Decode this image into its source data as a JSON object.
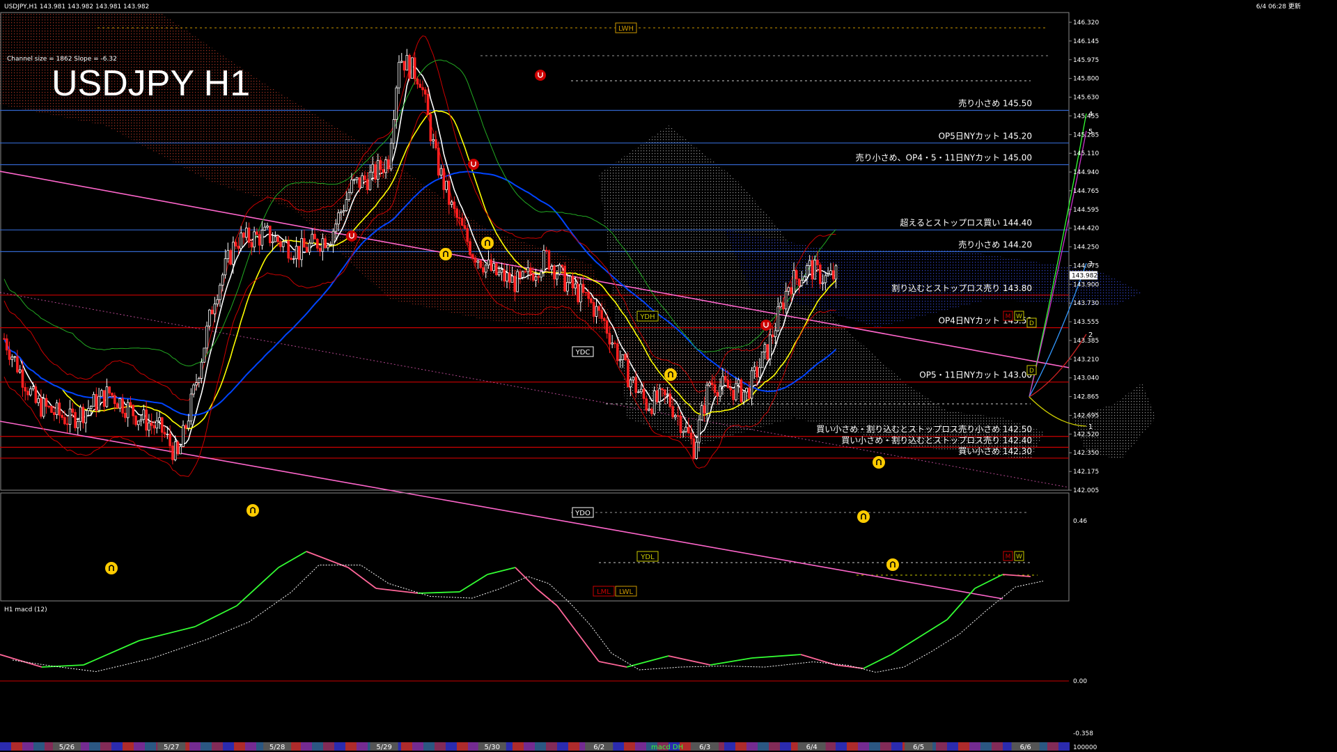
{
  "header": {
    "symbol_info": "USDJPY,H1  143.981 143.982 143.981 143.982",
    "updated": "6/4 06:28 更新",
    "channel_info": "Channel size = 1862 Slope = -6.32"
  },
  "title": "USDJPY H1",
  "macd_label": "H1  macd (12)",
  "colors": {
    "background": "#000000",
    "frame": "#8a8a8a",
    "candle_up": "#ffffff",
    "candle_down": "#ff2020",
    "resistance_line": "#3366cc",
    "support_line": "#cc0000",
    "channel_line": "#ff66cc",
    "ma_white": "#ffffff",
    "ma_yellow": "#ffff00",
    "ma_blue": "#0044ff",
    "macd_main_up": "#33ff33",
    "macd_main_down": "#ff6699",
    "macd_signal": "#ffffff"
  },
  "chart_data": {
    "type": "candlestick",
    "price_axis": {
      "range": [
        142.005,
        146.4
      ],
      "ticks": [
        "146.320",
        "146.145",
        "145.975",
        "145.800",
        "145.630",
        "145.455",
        "145.285",
        "145.110",
        "144.940",
        "144.765",
        "144.595",
        "144.420",
        "144.250",
        "144.075",
        "143.900",
        "143.730",
        "143.555",
        "143.385",
        "143.210",
        "143.040",
        "142.865",
        "142.695",
        "142.520",
        "142.350",
        "142.175",
        "142.005"
      ],
      "current_price": "143.982"
    },
    "x_labels": [
      "5/26",
      "5/27",
      "5/28",
      "5/29",
      "5/30",
      "6/2",
      "6/3",
      "6/4",
      "6/5",
      "6/6"
    ],
    "macd_axis": {
      "ticks": [
        "0.46",
        "0.00",
        "-0.358"
      ]
    },
    "bottom_label": "macd DH",
    "volume_label": "100000",
    "level_lines": [
      {
        "price": 145.5,
        "label": "売り小さめ 145.50",
        "kind": "resistance"
      },
      {
        "price": 145.2,
        "label": "OP5日NYカット 145.20",
        "kind": "resistance"
      },
      {
        "price": 145.0,
        "label": "売り小さめ、OP4・5・11日NYカット 145.00",
        "kind": "resistance"
      },
      {
        "price": 144.4,
        "label": "超えるとストップロス買い 144.40",
        "kind": "resistance"
      },
      {
        "price": 144.2,
        "label": "売り小さめ 144.20",
        "kind": "resistance"
      },
      {
        "price": 143.8,
        "label": "割り込むとストップロス売り 143.80",
        "kind": "support"
      },
      {
        "price": 143.5,
        "label": "OP4日NYカット 143.50",
        "kind": "support"
      },
      {
        "price": 143.0,
        "label": "OP5・11日NYカット 143.00",
        "kind": "support"
      },
      {
        "price": 142.5,
        "label": "買い小さめ・割り込むとストップロス売り小さめ 142.50",
        "kind": "support"
      },
      {
        "price": 142.4,
        "label": "買い小さめ・割り込むとストップロス売り 142.40",
        "kind": "support"
      },
      {
        "price": 142.3,
        "label": "買い小さめ 142.30",
        "kind": "support"
      }
    ],
    "marker_tags": [
      {
        "label": "LWH",
        "price": 146.27
      },
      {
        "label": "YDH",
        "price": 144.14
      },
      {
        "label": "YDC",
        "price": 143.93
      },
      {
        "label": "YDO",
        "price": 142.66
      },
      {
        "label": "YDL",
        "price": 142.35
      },
      {
        "label": "LML",
        "price": 142.08
      },
      {
        "label": "LWL",
        "price": 142.08
      }
    ],
    "forecast_numbers": [
      "4",
      "5",
      "3",
      "2",
      "1"
    ],
    "mw_tags": [
      "M",
      "W",
      "D",
      "D",
      "M",
      "W"
    ]
  }
}
